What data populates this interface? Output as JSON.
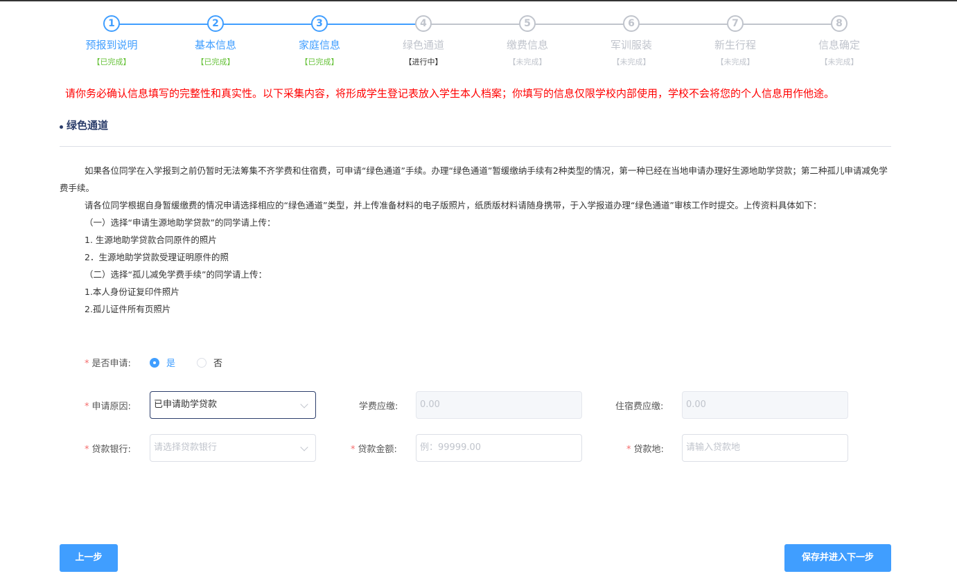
{
  "steps": [
    {
      "num": "1",
      "title": "预报到说明",
      "status": "【已完成】"
    },
    {
      "num": "2",
      "title": "基本信息",
      "status": "【已完成】"
    },
    {
      "num": "3",
      "title": "家庭信息",
      "status": "【已完成】"
    },
    {
      "num": "4",
      "title": "绿色通道",
      "status": "【进行中】"
    },
    {
      "num": "5",
      "title": "缴费信息",
      "status": "【未完成】"
    },
    {
      "num": "6",
      "title": "军训服装",
      "status": "【未完成】"
    },
    {
      "num": "7",
      "title": "新生行程",
      "status": "【未完成】"
    },
    {
      "num": "8",
      "title": "信息确定",
      "status": "【未完成】"
    }
  ],
  "notice": "请你务必确认信息填写的完整性和真实性。以下采集内容，将形成学生登记表放入学生本人档案；你填写的信息仅限学校内部使用，学校不会将您的个人信息用作他途。",
  "section_title": "绿色通道",
  "content": {
    "p1": "如果各位同学在入学报到之前仍暂时无法筹集不齐学费和住宿费，可申请“绿色通道”手续。办理“绿色通道”暂缓缴纳手续有2种类型的情况，第一种已经在当地申请办理好生源地助学贷款；第二种孤儿申请减免学费手续。",
    "p2": "请各位同学根据自身暂缓缴费的情况申请选择相应的“绿色通道”类型，并上传准备材料的电子版照片，纸质版材料请随身携带，于入学报道办理“绿色通道”审核工作时提交。上传资料具体如下：",
    "l1": "（一）选择“申请生源地助学贷款”的同学请上传：",
    "l2": "1. 生源地助学贷款合同原件的照片",
    "l3": "2．生源地助学贷款受理证明原件的照",
    "l4": "（二）选择“孤儿减免学费手续”的同学请上传：",
    "l5": "1.本人身份证复印件照片",
    "l6": "2.孤儿证件所有页照片"
  },
  "form": {
    "apply_label": "是否申请:",
    "apply_yes": "是",
    "apply_no": "否",
    "reason_label": "申请原因:",
    "reason_value": "已申请助学贷款",
    "tuition_label": "学费应缴:",
    "tuition_value": "0.00",
    "dorm_label": "住宿费应缴:",
    "dorm_value": "0.00",
    "bank_label": "贷款银行:",
    "bank_placeholder": "请选择贷款银行",
    "amount_label": "贷款金额:",
    "amount_placeholder": "例：99999.00",
    "place_label": "贷款地:",
    "place_placeholder": "请输入贷款地",
    "required_mark": "*"
  },
  "buttons": {
    "prev": "上一步",
    "next": "保存并进入下一步"
  }
}
